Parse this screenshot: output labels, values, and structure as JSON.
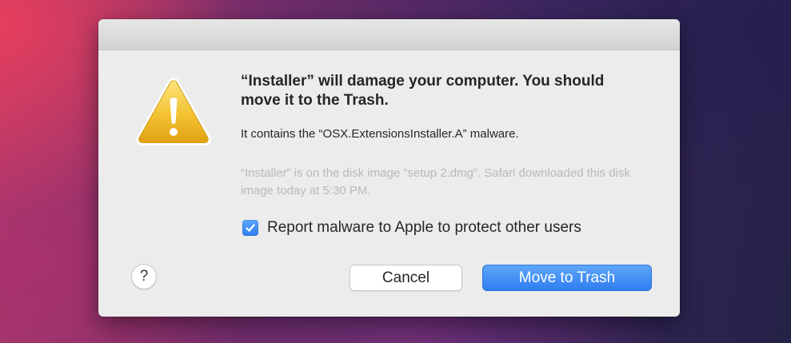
{
  "dialog": {
    "headline": "“Installer” will damage your computer. You should move it to the Trash.",
    "subline": "It contains the “OSX.ExtensionsInstaller.A” malware.",
    "detail": "“Installer” is on the disk image “setup 2.dmg”. Safari downloaded this disk image today at 5:30 PM.",
    "report_checkbox": {
      "label": "Report malware to Apple to protect other users",
      "checked": true
    },
    "help_button": {
      "label": "?"
    },
    "buttons": {
      "cancel": "Cancel",
      "move_to_trash": "Move to Trash"
    },
    "icon": "warning-triangle-icon"
  },
  "colors": {
    "accent_blue": "#2f7df1",
    "warning_yellow": "#f2c22c",
    "dialog_background": "#ececec"
  }
}
